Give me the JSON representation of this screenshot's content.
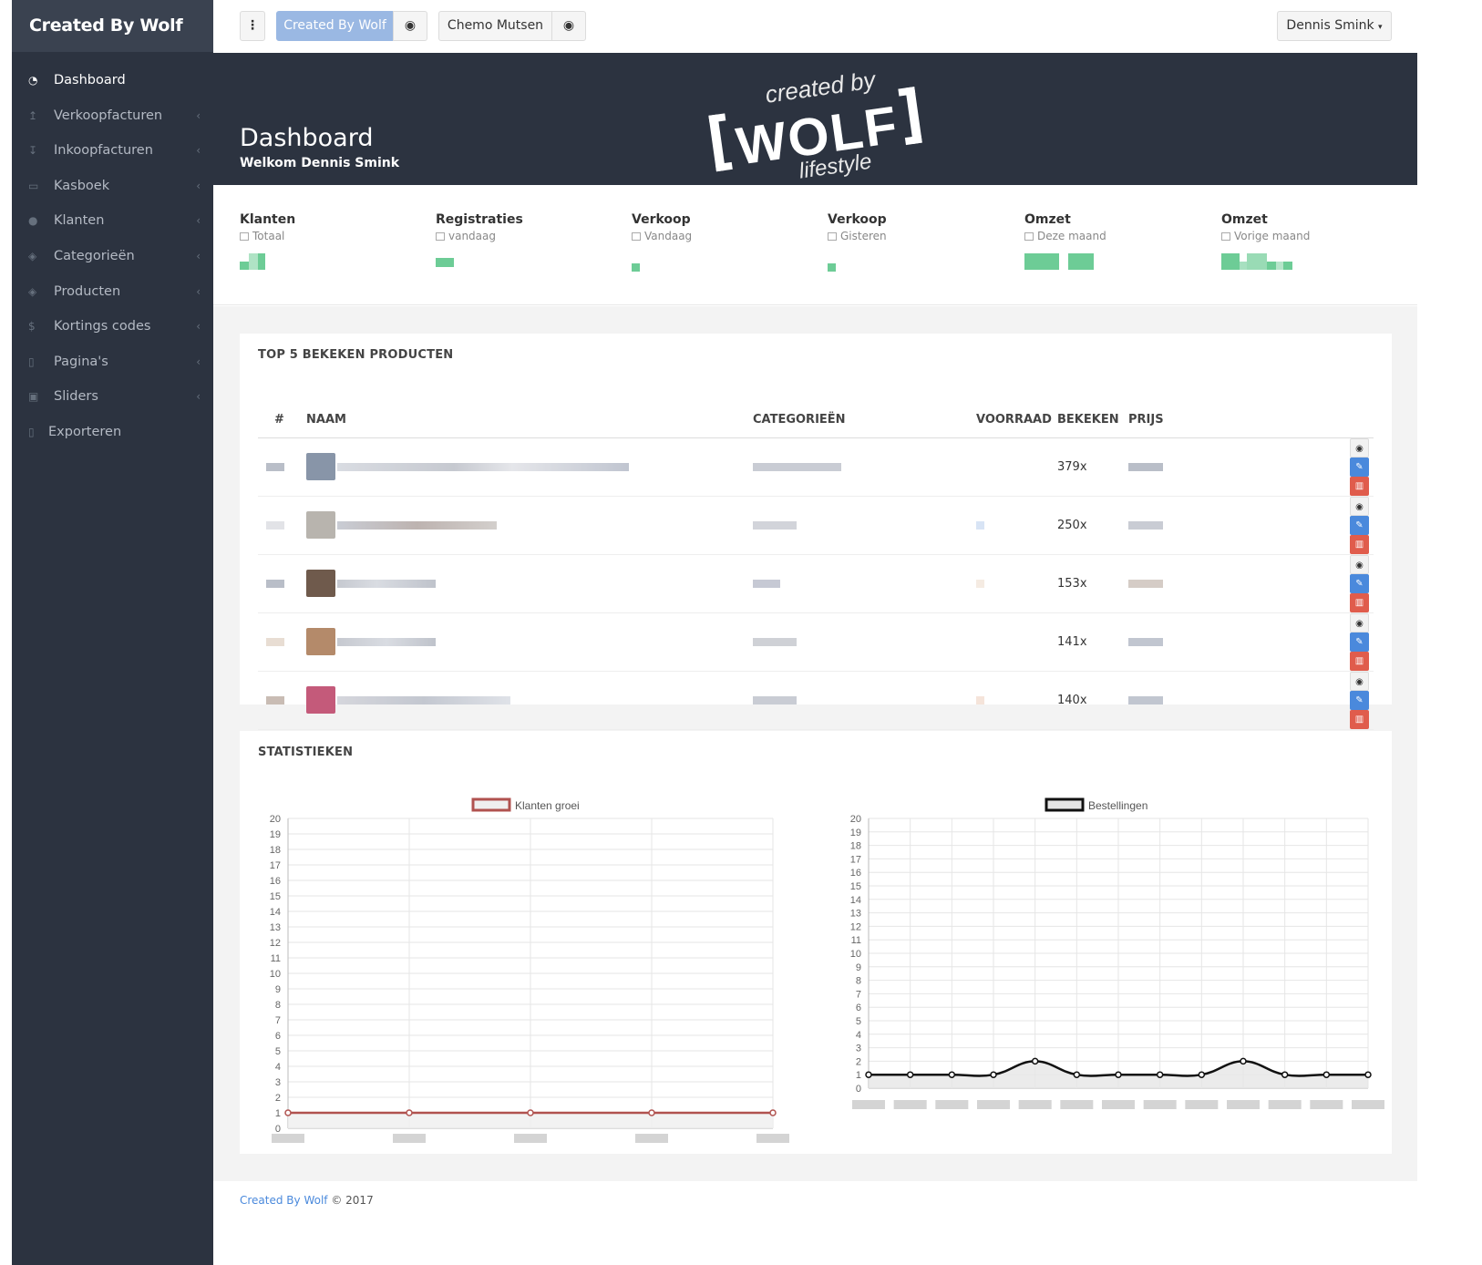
{
  "sidebar": {
    "brand": "Created By Wolf",
    "items": [
      {
        "label": "Dashboard",
        "icon": "dashboard-icon",
        "has_submenu": false
      },
      {
        "label": "Verkoopfacturen",
        "icon": "upload-icon",
        "has_submenu": true
      },
      {
        "label": "Inkoopfacturen",
        "icon": "download-icon",
        "has_submenu": true
      },
      {
        "label": "Kasboek",
        "icon": "money-icon",
        "has_submenu": true
      },
      {
        "label": "Klanten",
        "icon": "users-icon",
        "has_submenu": true
      },
      {
        "label": "Categorieën",
        "icon": "cube-icon",
        "has_submenu": true
      },
      {
        "label": "Producten",
        "icon": "cube-icon",
        "has_submenu": true
      },
      {
        "label": "Kortings codes",
        "icon": "dollar-icon",
        "has_submenu": true
      },
      {
        "label": "Pagina's",
        "icon": "file-icon",
        "has_submenu": true
      },
      {
        "label": "Sliders",
        "icon": "image-icon",
        "has_submenu": true
      },
      {
        "label": "Exporteren",
        "icon": "export-icon",
        "has_submenu": false
      }
    ]
  },
  "topbar": {
    "menu_icon": "vertical-dots-icon",
    "shops": [
      {
        "label": "Created By Wolf",
        "active": true
      },
      {
        "label": "Chemo Mutsen",
        "active": false
      }
    ],
    "user": "Dennis Smink"
  },
  "banner": {
    "title": "Dashboard",
    "subtitle": "Welkom Dennis Smink"
  },
  "stats": [
    {
      "label": "Klanten",
      "sub": "Totaal"
    },
    {
      "label": "Registraties",
      "sub": "vandaag"
    },
    {
      "label": "Verkoop",
      "sub": "Vandaag"
    },
    {
      "label": "Verkoop",
      "sub": "Gisteren"
    },
    {
      "label": "Omzet",
      "sub": "Deze maand"
    },
    {
      "label": "Omzet",
      "sub": "Vorige maand"
    }
  ],
  "top_products": {
    "title": "TOP 5 BEKEKEN PRODUCTEN",
    "columns": [
      "#",
      "NAAM",
      "CATEGORIEËN",
      "VOORRAAD",
      "BEKEKEN",
      "PRIJS"
    ],
    "rows": [
      {
        "views": "379x"
      },
      {
        "views": "250x"
      },
      {
        "views": "153x"
      },
      {
        "views": "141x"
      },
      {
        "views": "140x"
      }
    ]
  },
  "statistics": {
    "title": "STATISTIEKEN"
  },
  "chart_data": [
    {
      "type": "line",
      "legend": "Klanten groei",
      "series": [
        {
          "name": "Klanten groei",
          "values": [
            1,
            1,
            1,
            1,
            1
          ]
        }
      ],
      "ylim": [
        0,
        20
      ],
      "yticks": [
        0,
        1,
        2,
        3,
        4,
        5,
        6,
        7,
        8,
        9,
        10,
        11,
        12,
        13,
        14,
        15,
        16,
        17,
        18,
        19,
        20
      ],
      "color": "#b0524f",
      "fill": "#efefef",
      "grid": true,
      "legend_position": "top-center"
    },
    {
      "type": "line",
      "legend": "Bestellingen",
      "series": [
        {
          "name": "Bestellingen",
          "values": [
            1,
            1,
            1,
            1,
            2,
            1,
            1,
            1,
            1,
            2,
            1,
            1,
            1
          ]
        }
      ],
      "ylim": [
        0,
        20
      ],
      "yticks": [
        0,
        1,
        2,
        3,
        4,
        5,
        6,
        7,
        8,
        9,
        10,
        11,
        12,
        13,
        14,
        15,
        16,
        17,
        18,
        19,
        20
      ],
      "color": "#111111",
      "fill": "#e6e6e6",
      "grid": true,
      "legend_position": "top-center"
    }
  ],
  "footer": {
    "link": "Created By Wolf",
    "text": "© 2017"
  },
  "colors": {
    "sidebar": "#2c3340",
    "accent": "#4a89dc",
    "danger": "#e05c4c",
    "stat_value": "#6dcc96"
  }
}
